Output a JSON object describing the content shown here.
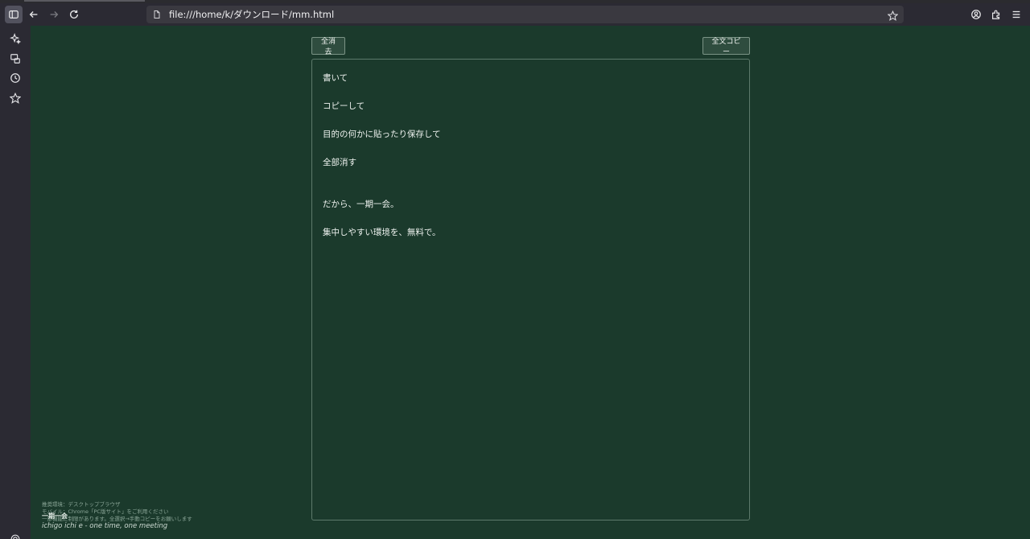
{
  "browser": {
    "url": "file:///home/k/ダウンロード/mm.html"
  },
  "page": {
    "buttons": {
      "clear_all": "全消去",
      "copy_all": "全文コピー"
    },
    "editor_lines": [
      "書いて",
      "コピーして",
      "目的の何かに貼ったり保存して",
      "全部消す",
      "だから、一期一会。",
      "集中しやすい環境を、無料で。"
    ],
    "footer": {
      "recommended": "推奨環境：デスクトップブラウザ",
      "mobile": "モバイル：Chrome「PC版サイト」をご利用ください",
      "note": "一部機能に制限があります。全選択→手動コピーをお願いします",
      "brand": "一期一会",
      "tagline": "ichigo ichi e - one time, one meeting"
    }
  },
  "colors": {
    "page_bg": "#1b3a2c",
    "chrome_bg": "#2b2a33",
    "urlbar_bg": "#3a3940"
  },
  "icons": {
    "toolbar": [
      "sidebar-toggle-icon",
      "back-arrow-icon",
      "forward-arrow-icon",
      "reload-icon",
      "page-icon",
      "bookmark-star-icon",
      "account-icon",
      "extensions-icon",
      "menu-icon"
    ],
    "sidebar": [
      "ai-sparkle-icon",
      "synced-tabs-icon",
      "history-icon",
      "bookmarks-icon",
      "settings-icon"
    ]
  }
}
